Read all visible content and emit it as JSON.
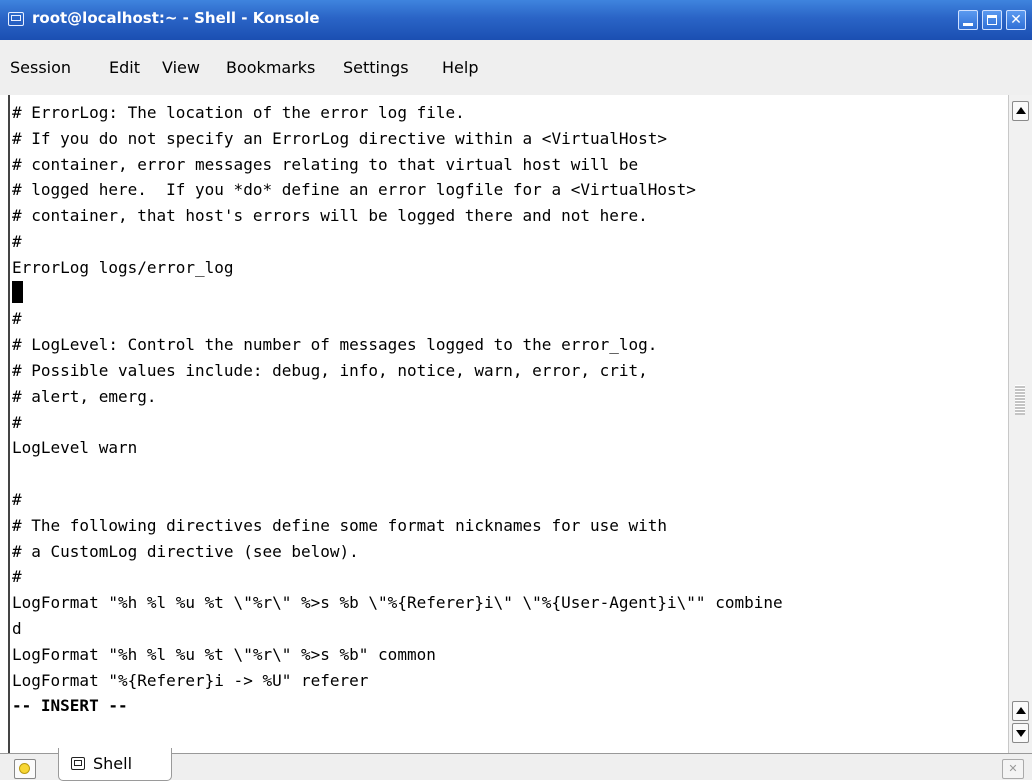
{
  "window": {
    "title": "root@localhost:~ - Shell - Konsole",
    "app_icon": "konsole-terminal-icon",
    "controls": [
      "minimize-icon",
      "maximize-icon",
      "close-icon"
    ]
  },
  "menubar": {
    "items": [
      "Session",
      "Edit",
      "View",
      "Bookmarks",
      "Settings",
      "Help"
    ]
  },
  "terminal": {
    "lines": [
      "# ErrorLog: The location of the error log file.",
      "# If you do not specify an ErrorLog directive within a <VirtualHost>",
      "# container, error messages relating to that virtual host will be",
      "# logged here.  If you *do* define an error logfile for a <VirtualHost>",
      "# container, that host's errors will be logged there and not here.",
      "#",
      "ErrorLog logs/error_log",
      "",
      "#",
      "# LogLevel: Control the number of messages logged to the error_log.",
      "# Possible values include: debug, info, notice, warn, error, crit,",
      "# alert, emerg.",
      "#",
      "LogLevel warn",
      "",
      "#",
      "# The following directives define some format nicknames for use with",
      "# a CustomLog directive (see below).",
      "#",
      "LogFormat \"%h %l %u %t \\\"%r\\\" %>s %b \\\"%{Referer}i\\\" \\\"%{User-Agent}i\\\"\" combine",
      "d",
      "LogFormat \"%h %l %u %t \\\"%r\\\" %>s %b\" common",
      "LogFormat \"%{Referer}i -> %U\" referer"
    ],
    "mode_line": "-- INSERT --"
  },
  "tabbar": {
    "new_tab_icon": "new-session-icon",
    "tab_icon": "shell-icon",
    "tab_label": "Shell",
    "close_icon": "close-session-icon"
  }
}
